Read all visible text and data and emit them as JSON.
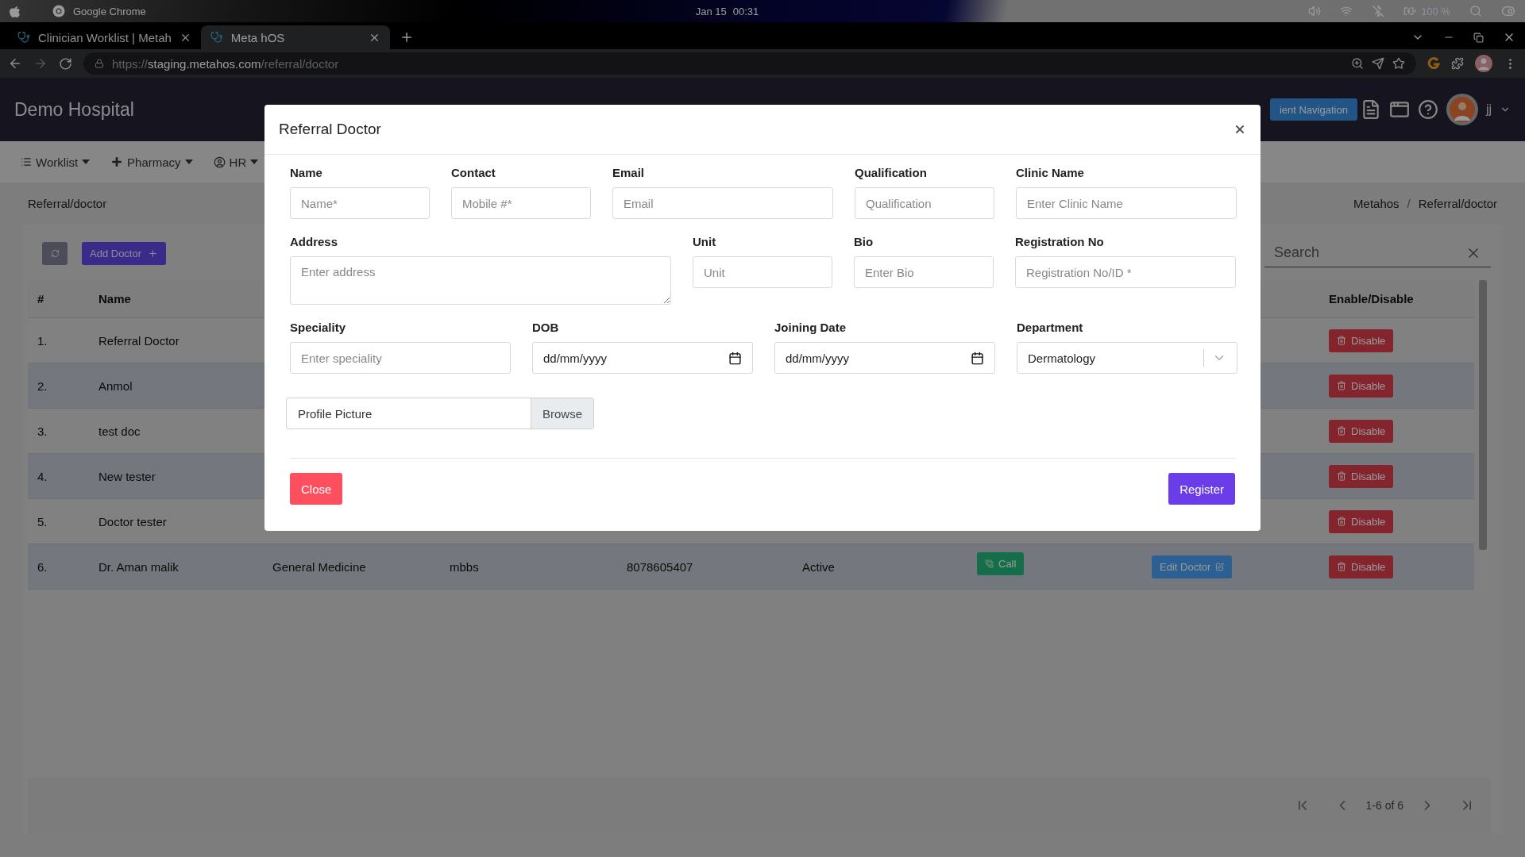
{
  "os_bar": {
    "app": "Google Chrome",
    "date": "Jan 15",
    "time": "00:31",
    "battery": "100 %"
  },
  "browser": {
    "tabs": [
      {
        "title": "Clinician Worklist | Metah",
        "selected": false
      },
      {
        "title": "Meta hOS",
        "selected": true
      }
    ],
    "url": {
      "scheme": "https://",
      "host": "staging.metahos.com",
      "path": "/referral/doctor"
    }
  },
  "app_header": {
    "title": "Demo Hospital",
    "nav_button": "ient Navigation",
    "user": "jj"
  },
  "nav": [
    {
      "label": "Worklist",
      "kind": "list"
    },
    {
      "label": "Pharmacy",
      "kind": "plus"
    },
    {
      "label": "HR",
      "kind": "user"
    }
  ],
  "breadcrumb": {
    "page": "Referral/doctor",
    "trail": [
      "Metahos",
      "Referral/doctor"
    ],
    "separator": "/"
  },
  "toolbar": {
    "add_button": "Add Doctor",
    "search": {
      "placeholder": "Search"
    }
  },
  "table": {
    "header": {
      "number": "#",
      "name": "Name",
      "actions": "Enable/Disable"
    },
    "rows": [
      {
        "number": "1.",
        "name": "Referral Doctor",
        "disable": "Disable"
      },
      {
        "number": "2.",
        "name": "Anmol",
        "disable": "Disable"
      },
      {
        "number": "3.",
        "name": "test doc",
        "disable": "Disable"
      },
      {
        "number": "4.",
        "name": "New tester",
        "disable": "Disable"
      },
      {
        "number": "5.",
        "name": "Doctor tester",
        "disable": "Disable"
      },
      {
        "number": "6.",
        "name": "Dr. Aman malik",
        "speciality": "General Medicine",
        "qualification": "mbbs",
        "contact": "8078605407",
        "status": "Active",
        "call": "Call",
        "edit": "Edit Doctor",
        "disable": "Disable"
      }
    ]
  },
  "pagination": "1-6 of 6",
  "modal": {
    "title": "Referral Doctor",
    "rows": [
      [
        {
          "label": "Name",
          "kind": "text",
          "placeholder": "Name*"
        },
        {
          "label": "Contact",
          "kind": "text",
          "placeholder": "Mobile #*"
        },
        {
          "label": "Email",
          "kind": "text",
          "placeholder": "Email"
        },
        {
          "label": "Qualification",
          "kind": "text",
          "placeholder": "Qualification"
        },
        {
          "label": "Clinic Name",
          "kind": "text",
          "placeholder": "Enter Clinic Name"
        }
      ],
      [
        {
          "label": "Address",
          "kind": "textarea",
          "placeholder": "Enter address"
        },
        {
          "label": "Unit",
          "kind": "text",
          "placeholder": "Unit"
        },
        {
          "label": "Bio",
          "kind": "text",
          "placeholder": "Enter Bio"
        },
        {
          "label": "Registration No",
          "kind": "text",
          "placeholder": "Registration No/ID *"
        }
      ],
      [
        {
          "label": "Speciality",
          "kind": "text",
          "placeholder": "Enter speciality"
        },
        {
          "label": "DOB",
          "kind": "date",
          "value": "dd/mm/yyyy"
        },
        {
          "label": "Joining Date",
          "kind": "date",
          "value": "dd/mm/yyyy"
        },
        {
          "label": "Department",
          "kind": "select",
          "value": "Dermatology"
        }
      ]
    ],
    "file": {
      "placeholder": "Profile Picture",
      "button": "Browse"
    },
    "buttons": {
      "close": "Close",
      "submit": "Register"
    }
  }
}
